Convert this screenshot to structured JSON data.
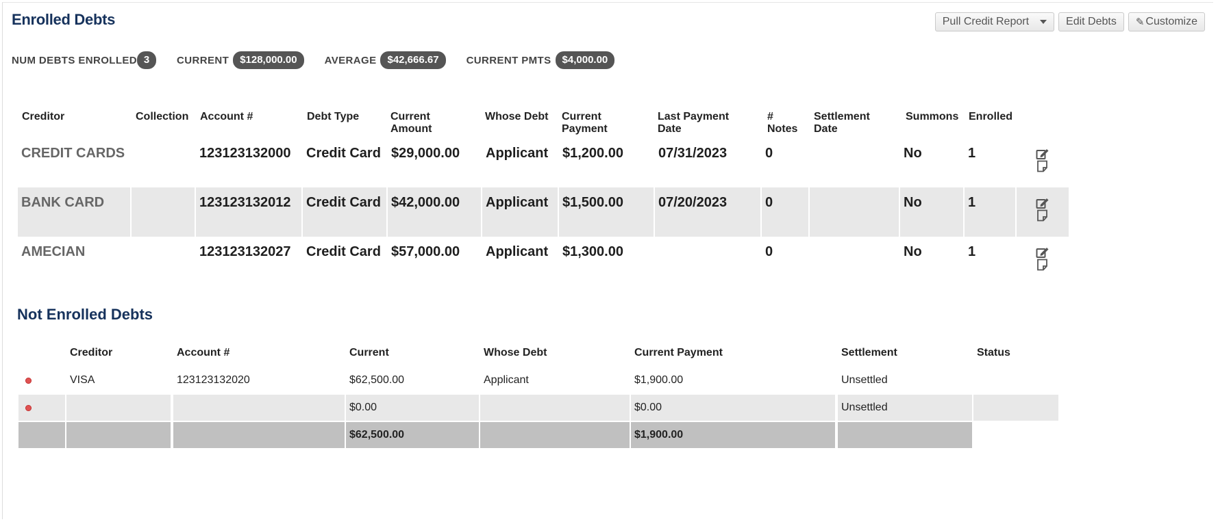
{
  "enrolled": {
    "title": "Enrolled Debts",
    "toolbar": {
      "pull_credit": "Pull Credit Report",
      "edit_debts": "Edit Debts",
      "customize": "Customize"
    },
    "stats": [
      {
        "label": "NUM DEBTS ENROLLED",
        "value": "3"
      },
      {
        "label": "CURRENT",
        "value": "$128,000.00"
      },
      {
        "label": "AVERAGE",
        "value": "$42,666.67"
      },
      {
        "label": "CURRENT PMTS",
        "value": "$4,000.00"
      }
    ],
    "columns": {
      "creditor": "Creditor",
      "collection": "Collection",
      "account": "Account #",
      "debt_type": "Debt Type",
      "current_amount": "Current Amount",
      "whose_debt": "Whose Debt",
      "current_payment": "Current Payment",
      "last_payment_date": "Last Payment Date",
      "notes": "# Notes",
      "settlement_date": "Settlement Date",
      "summons": "Summons",
      "enrolled": "Enrolled"
    },
    "rows": [
      {
        "creditor": "CREDIT CARDS",
        "collection": "",
        "account": "123123132000",
        "debt_type": "Credit Card",
        "current_amount": "$29,000.00",
        "whose_debt": "Applicant",
        "current_payment": "$1,200.00",
        "last_payment_date": "07/31/2023",
        "notes": "0",
        "settlement_date": "",
        "summons": "No",
        "enrolled": "1"
      },
      {
        "creditor": "BANK CARD",
        "collection": "",
        "account": "123123132012",
        "debt_type": "Credit Card",
        "current_amount": "$42,000.00",
        "whose_debt": "Applicant",
        "current_payment": "$1,500.00",
        "last_payment_date": "07/20/2023",
        "notes": "0",
        "settlement_date": "",
        "summons": "No",
        "enrolled": "1"
      },
      {
        "creditor": "AMECIAN",
        "collection": "",
        "account": "123123132027",
        "debt_type": "Credit Card",
        "current_amount": "$57,000.00",
        "whose_debt": "Applicant",
        "current_payment": "$1,300.00",
        "last_payment_date": "",
        "notes": "0",
        "settlement_date": "",
        "summons": "No",
        "enrolled": "1"
      }
    ]
  },
  "not_enrolled": {
    "title": "Not Enrolled Debts",
    "columns": {
      "creditor": "Creditor",
      "account": "Account #",
      "current": "Current",
      "whose_debt": "Whose Debt",
      "current_payment": "Current Payment",
      "settlement": "Settlement",
      "status": "Status"
    },
    "rows": [
      {
        "creditor": "VISA",
        "account": "123123132020",
        "current": "$62,500.00",
        "whose_debt": "Applicant",
        "current_payment": "$1,900.00",
        "settlement": "Unsettled",
        "status": ""
      },
      {
        "creditor": "",
        "account": "",
        "current": "$0.00",
        "whose_debt": "",
        "current_payment": "$0.00",
        "settlement": "Unsettled",
        "status": ""
      }
    ],
    "totals": {
      "current": "$62,500.00",
      "current_payment": "$1,900.00"
    }
  },
  "icons": {
    "edit": "edit-icon",
    "note": "note-icon",
    "status_dot": "status-dot-icon",
    "dropdown": "caret-down-icon",
    "customize": "pencil-icon"
  },
  "colors": {
    "heading": "#16325c",
    "badge_bg": "#555555",
    "row_shade": "#e8e8e8",
    "total_shade": "#c0c0c0",
    "status_dot": "#e05252"
  }
}
